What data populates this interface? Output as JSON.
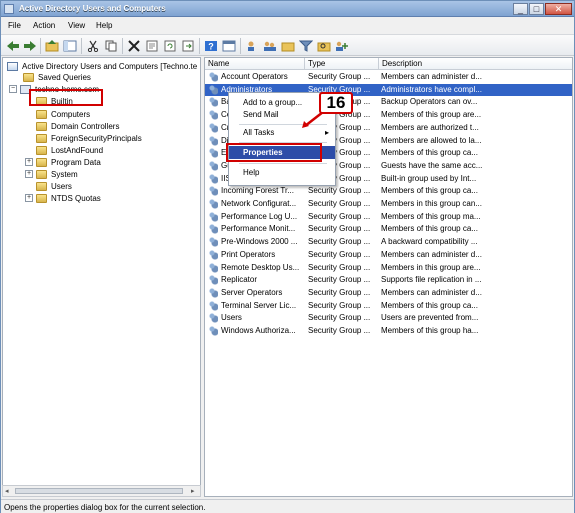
{
  "window": {
    "title": "Active Directory Users and Computers",
    "minimize": "_",
    "maximize": "□",
    "close": "✕"
  },
  "menubar": {
    "file": "File",
    "action": "Action",
    "view": "View",
    "help": "Help"
  },
  "toolbar": {
    "icons": [
      "back-icon",
      "forward-icon",
      "up-icon",
      "tree-icon",
      "cut-icon",
      "copy-icon",
      "delete-icon",
      "properties-icon",
      "refresh-icon",
      "export-icon",
      "help-icon",
      "console-icon",
      "user-icon",
      "group-icon",
      "filter-icon",
      "find-icon",
      "add-icon"
    ]
  },
  "tree": {
    "root": "Active Directory Users and Computers [Techno.te",
    "saved_queries": "Saved Queries",
    "domain": "techno-home.com",
    "builtin": "Builtin",
    "computers": "Computers",
    "domain_controllers": "Domain Controllers",
    "fsp": "ForeignSecurityPrincipals",
    "lostandfound": "LostAndFound",
    "program_data": "Program Data",
    "system": "System",
    "users": "Users",
    "ntds_quotas": "NTDS Quotas",
    "expand": "+",
    "collapse": "−"
  },
  "list": {
    "headers": {
      "name": "Name",
      "type": "Type",
      "description": "Description"
    },
    "rows": [
      {
        "name": "Account Operators",
        "type": "Security Group ...",
        "desc": "Members can administer d..."
      },
      {
        "name": "Administrators",
        "type": "Security Group ...",
        "desc": "Administrators have compl..."
      },
      {
        "name": "Bac",
        "type": "Security Group ...",
        "desc": "Backup Operators can ov..."
      },
      {
        "name": "Ce",
        "type": "Security Group ...",
        "desc": "Members of this group are..."
      },
      {
        "name": "Cr",
        "type": "Security Group ...",
        "desc": "Members are authorized t..."
      },
      {
        "name": "Dis",
        "type": "Security Group ...",
        "desc": "Members are allowed to la..."
      },
      {
        "name": "Ev",
        "type": "Security Group ...",
        "desc": "Members of this group ca..."
      },
      {
        "name": "Gu",
        "type": "Security Group ...",
        "desc": "Guests have the same acc..."
      },
      {
        "name": "IIS_IUSRS",
        "type": "Security Group ...",
        "desc": "Built-in group used by Int..."
      },
      {
        "name": "Incoming Forest Tr...",
        "type": "Security Group ...",
        "desc": "Members of this group ca..."
      },
      {
        "name": "Network Configurat...",
        "type": "Security Group ...",
        "desc": "Members in this group can..."
      },
      {
        "name": "Performance Log U...",
        "type": "Security Group ...",
        "desc": "Members of this group ma..."
      },
      {
        "name": "Performance Monit...",
        "type": "Security Group ...",
        "desc": "Members of this group ca..."
      },
      {
        "name": "Pre-Windows 2000 ...",
        "type": "Security Group ...",
        "desc": "A backward compatibility ..."
      },
      {
        "name": "Print Operators",
        "type": "Security Group ...",
        "desc": "Members can administer d..."
      },
      {
        "name": "Remote Desktop Us...",
        "type": "Security Group ...",
        "desc": "Members in this group are..."
      },
      {
        "name": "Replicator",
        "type": "Security Group ...",
        "desc": "Supports file replication in ..."
      },
      {
        "name": "Server Operators",
        "type": "Security Group ...",
        "desc": "Members can administer d..."
      },
      {
        "name": "Terminal Server Lic...",
        "type": "Security Group ...",
        "desc": "Members of this group ca..."
      },
      {
        "name": "Users",
        "type": "Security Group ...",
        "desc": "Users are prevented from..."
      },
      {
        "name": "Windows Authoriza...",
        "type": "Security Group ...",
        "desc": "Members of this group ha..."
      }
    ]
  },
  "context_menu": {
    "add_to_group": "Add to a group...",
    "send_mail": "Send Mail",
    "all_tasks": "All Tasks",
    "all_tasks_arrow": "▸",
    "properties": "Properties",
    "help": "Help"
  },
  "annotation": {
    "step": "16"
  },
  "status": {
    "text": "Opens the properties dialog box for the current selection."
  },
  "scroll": {
    "left_arrow": "◂",
    "right_arrow": "▸"
  }
}
